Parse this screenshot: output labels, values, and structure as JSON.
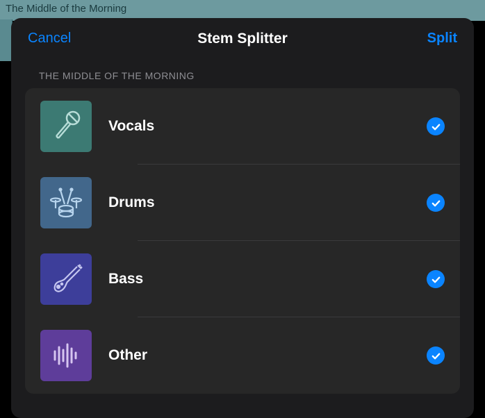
{
  "background": {
    "track_title": "The Middle of the Morning"
  },
  "modal": {
    "cancel_label": "Cancel",
    "title": "Stem Splitter",
    "split_label": "Split",
    "section_header": "THE MIDDLE OF THE MORNING",
    "stems": [
      {
        "label": "Vocals",
        "checked": true,
        "icon": "microphone",
        "color": "#3c7a73"
      },
      {
        "label": "Drums",
        "checked": true,
        "icon": "drums",
        "color": "#42678b"
      },
      {
        "label": "Bass",
        "checked": true,
        "icon": "bass",
        "color": "#3d3e9a"
      },
      {
        "label": "Other",
        "checked": true,
        "icon": "waveform",
        "color": "#5e3d9a"
      }
    ]
  },
  "colors": {
    "accent": "#0a84ff",
    "modal_bg": "#1c1c1e",
    "list_bg": "#272727"
  }
}
